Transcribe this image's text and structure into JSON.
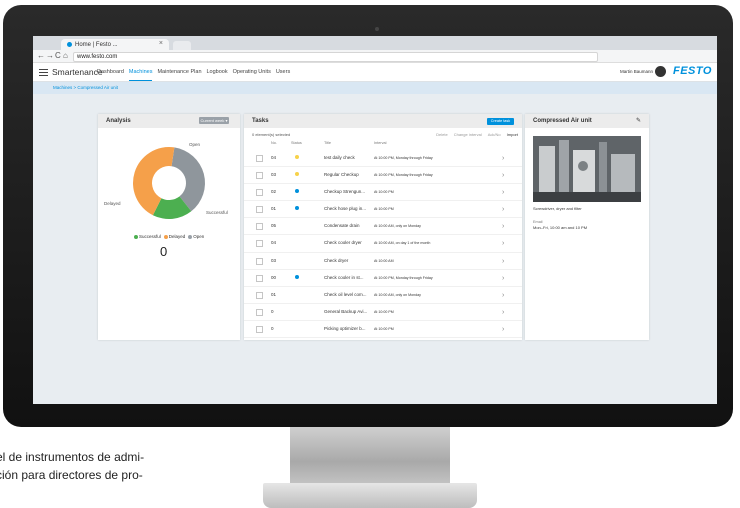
{
  "browser": {
    "tab_title": "Home | Festo ...",
    "tab_close": "×",
    "url": "www.festo.com",
    "back": "←",
    "forward": "→",
    "reload": "C",
    "home": "⌂"
  },
  "app": {
    "brand": "Smartenance",
    "nav": [
      "Dashboard",
      "Machines",
      "Maintenance Plan",
      "Logbook",
      "Operating Units",
      "Users"
    ],
    "active_nav": "Machines",
    "user_name": "Martin Baumann",
    "logo": "FESTO",
    "breadcrumb": "Machines > Compressed Air unit"
  },
  "analysis": {
    "title": "Analysis",
    "button": "Current week ▾",
    "legend": [
      "Successful",
      "Delayed",
      "Open"
    ],
    "legend_colors": [
      "#4caf50",
      "#f5a04a",
      "#9aa1a8"
    ],
    "count": "0",
    "slice_labels": [
      "Open",
      "Successful",
      "Delayed"
    ],
    "chart_data": {
      "type": "pie",
      "donut": true,
      "categories": [
        "Open",
        "Successful",
        "Delayed"
      ],
      "values": [
        37,
        18,
        45
      ],
      "colors": [
        "#8f969c",
        "#4caf50",
        "#f5a04a"
      ]
    }
  },
  "tasks": {
    "title": "Tasks",
    "new_button": "Create task",
    "selected": "0 element(s) selected",
    "actions": [
      "Delete",
      "Change interval",
      "Ack/No",
      "Import"
    ],
    "columns": [
      "No.",
      "Status",
      "Title",
      "Interval"
    ],
    "rows": [
      {
        "no": "04",
        "status": "#f7d24a",
        "title": "test daily check",
        "interval": "At 10:00 PM, Monday through Friday"
      },
      {
        "no": "03",
        "status": "#f7d24a",
        "title": "Regular Checkup",
        "interval": "At 10:00 PM, Monday through Friday"
      },
      {
        "no": "02",
        "status": "#0091dc",
        "title": "Checkup Strengun...",
        "interval": "At 10:00 PM"
      },
      {
        "no": "01",
        "status": "#0091dc",
        "title": "Check hose plug in...",
        "interval": "At 10:00 PM"
      },
      {
        "no": "05",
        "status": "",
        "title": "Condensate drain",
        "interval": "At 10:00 AM, only on Monday"
      },
      {
        "no": "04",
        "status": "",
        "title": "Check cooler dryer",
        "interval": "At 10:00 AM, on day 1 of the month"
      },
      {
        "no": "03",
        "status": "",
        "title": "Check dryer",
        "interval": "At 10:00 AM"
      },
      {
        "no": "00",
        "status": "#0091dc",
        "title": "Check cooler in st...",
        "interval": "At 10:00 PM, Monday through Friday"
      },
      {
        "no": "01",
        "status": "",
        "title": "Check oil level com...",
        "interval": "At 10:00 AM, only on Monday"
      },
      {
        "no": "0",
        "status": "",
        "title": "General Backup Avi...",
        "interval": "At 10:00 PM"
      },
      {
        "no": "0",
        "status": "",
        "title": "Picking optimizer b...",
        "interval": "At 10:00 PM"
      }
    ]
  },
  "unit": {
    "title": "Compressed Air unit",
    "edit_icon": "✎",
    "line1": "Screwdriver, dryer and filter",
    "label2": "Email",
    "line3": "Mon–Fri, 10:00 am and 10 PM"
  },
  "caption": {
    "line1": "el de instrumentos de admi-",
    "line2": "ción para directores de pro-"
  }
}
